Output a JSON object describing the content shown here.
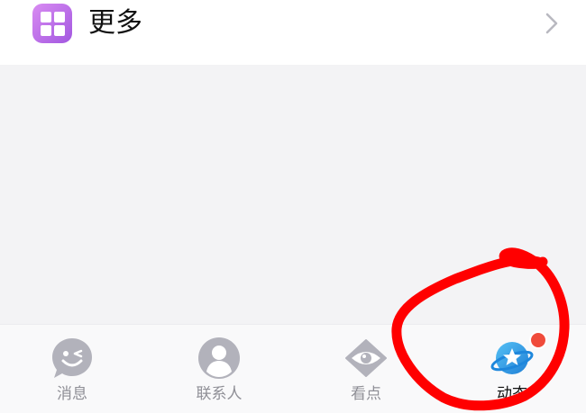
{
  "more_row": {
    "label": "更多",
    "icon": "grid-apps-icon",
    "chevron_icon": "chevron-right-icon"
  },
  "tab_bar": {
    "tabs": [
      {
        "label": "消息",
        "icon": "wink-face-bubble-icon",
        "active": false
      },
      {
        "label": "联系人",
        "icon": "person-avatar-icon",
        "active": false
      },
      {
        "label": "看点",
        "icon": "eye-icon",
        "active": false
      },
      {
        "label": "动态",
        "icon": "planet-star-icon",
        "active": true,
        "badge": true
      }
    ]
  },
  "colors": {
    "accent_purple": "#b06ae6",
    "inactive_icon": "#b2b2bb",
    "planet_blue": "#2f9de8",
    "badge_red": "#f04b3b",
    "annotation_red": "#ff0000"
  }
}
